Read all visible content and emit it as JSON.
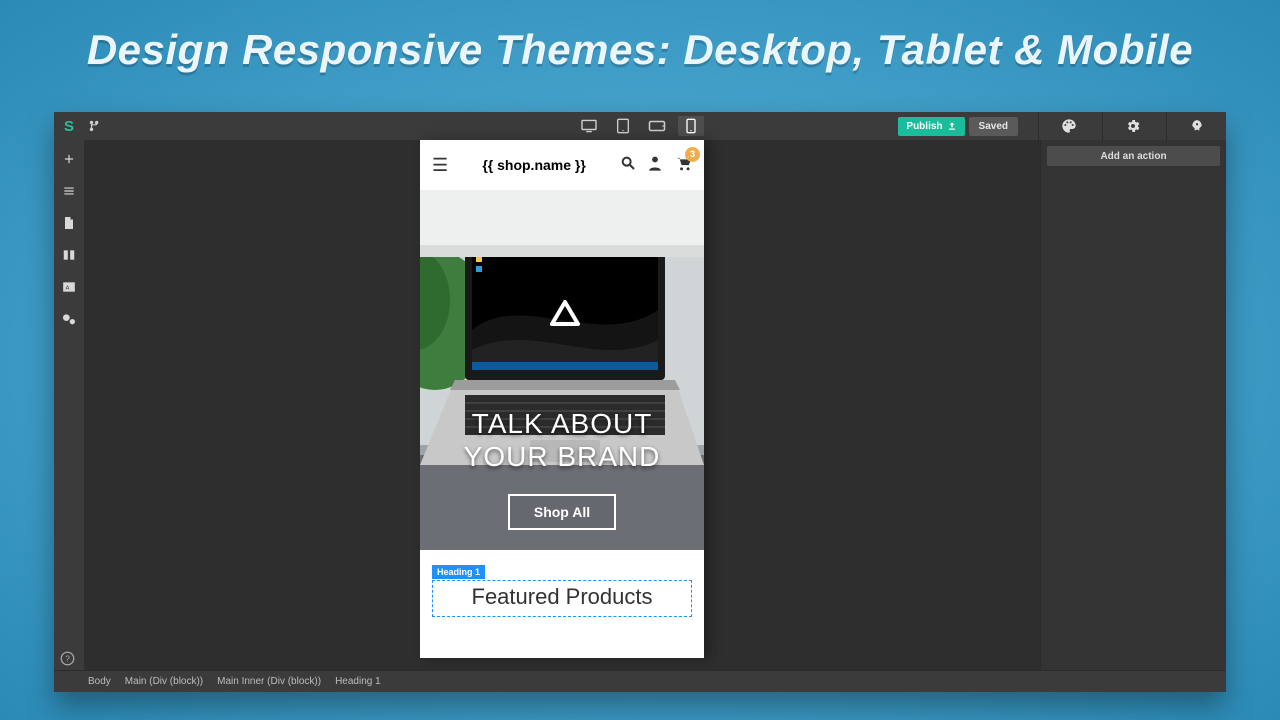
{
  "headline": "Design Responsive Themes: Desktop, Tablet & Mobile",
  "topbar": {
    "logo": "S",
    "publish_label": "Publish",
    "saved_label": "Saved"
  },
  "devices": {
    "items": [
      "desktop",
      "tablet",
      "landscape",
      "mobile"
    ],
    "active": "mobile"
  },
  "right_panel": {
    "add_action": "Add an action"
  },
  "sidebar_tools": [
    "plus",
    "list",
    "page",
    "columns",
    "text",
    "gears"
  ],
  "preview": {
    "shop_name": "{{ shop.name }}",
    "cart_badge": "3",
    "hero_line1": "TALK ABOUT",
    "hero_line2": "YOUR BRAND",
    "shop_all": "Shop All",
    "heading_tag": "Heading 1",
    "featured": "Featured Products"
  },
  "breadcrumb": [
    "Body",
    "Main (Div (block))",
    "Main Inner (Div (block))",
    "Heading 1"
  ]
}
